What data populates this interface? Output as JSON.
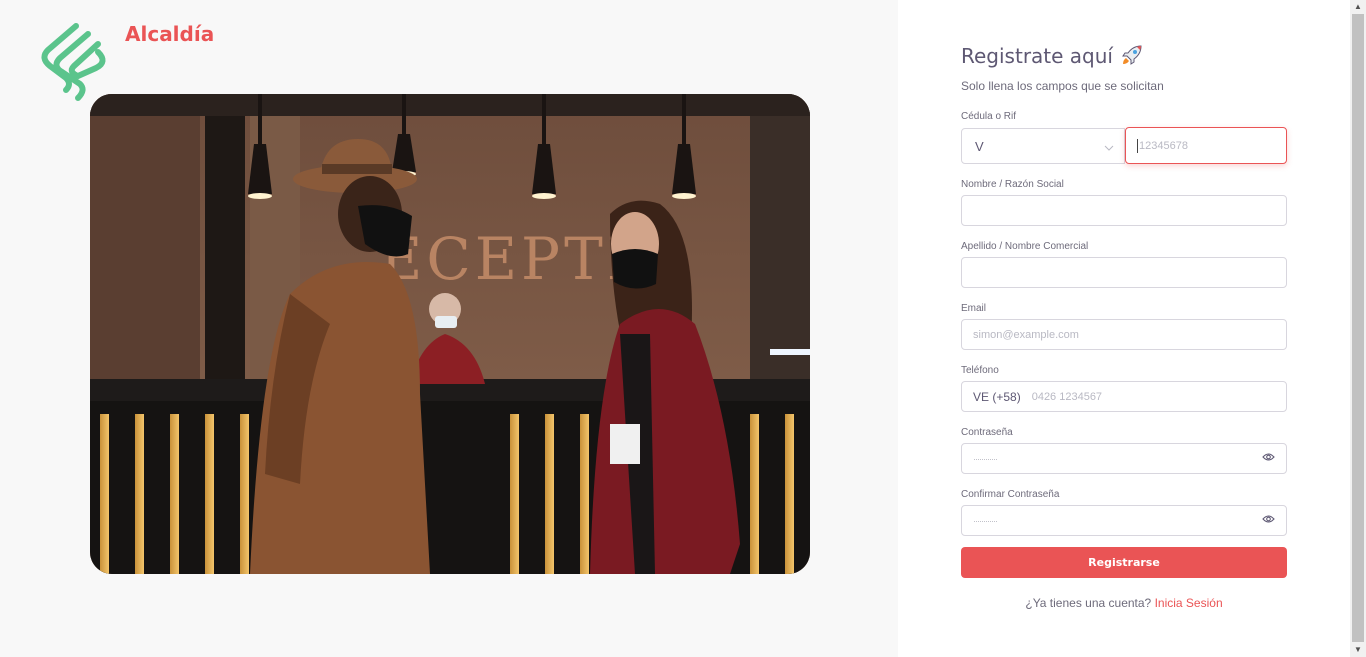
{
  "brand": {
    "name": "Alcaldía",
    "logo_icon": "stacked-s-logo-icon",
    "logo_color": "#5bc48c",
    "brand_color": "#ea5455"
  },
  "hero": {
    "image_icon": "reception-photo"
  },
  "form": {
    "title": "Registrate aquí",
    "title_icon": "rocket-icon",
    "subtitle": "Solo llena los campos que se solicitan",
    "cedula": {
      "label": "Cédula o Rif",
      "type_value": "V",
      "placeholder": "12345678"
    },
    "nombre": {
      "label": "Nombre / Razón Social",
      "value": ""
    },
    "apellido": {
      "label": "Apellido / Nombre Comercial",
      "value": ""
    },
    "email": {
      "label": "Email",
      "placeholder": "simon@example.com"
    },
    "telefono": {
      "label": "Teléfono",
      "prefix": "VE (+58)",
      "placeholder": "0426 1234567"
    },
    "password": {
      "label": "Contraseña",
      "placeholder": "············"
    },
    "confirm": {
      "label": "Confirmar Contraseña",
      "placeholder": "············"
    },
    "submit_label": "Registrarse",
    "footer_text": "¿Ya tienes una cuenta?",
    "footer_link": "Inicia Sesión"
  },
  "colors": {
    "accent": "#ea5455",
    "error_border": "#ea5455"
  }
}
